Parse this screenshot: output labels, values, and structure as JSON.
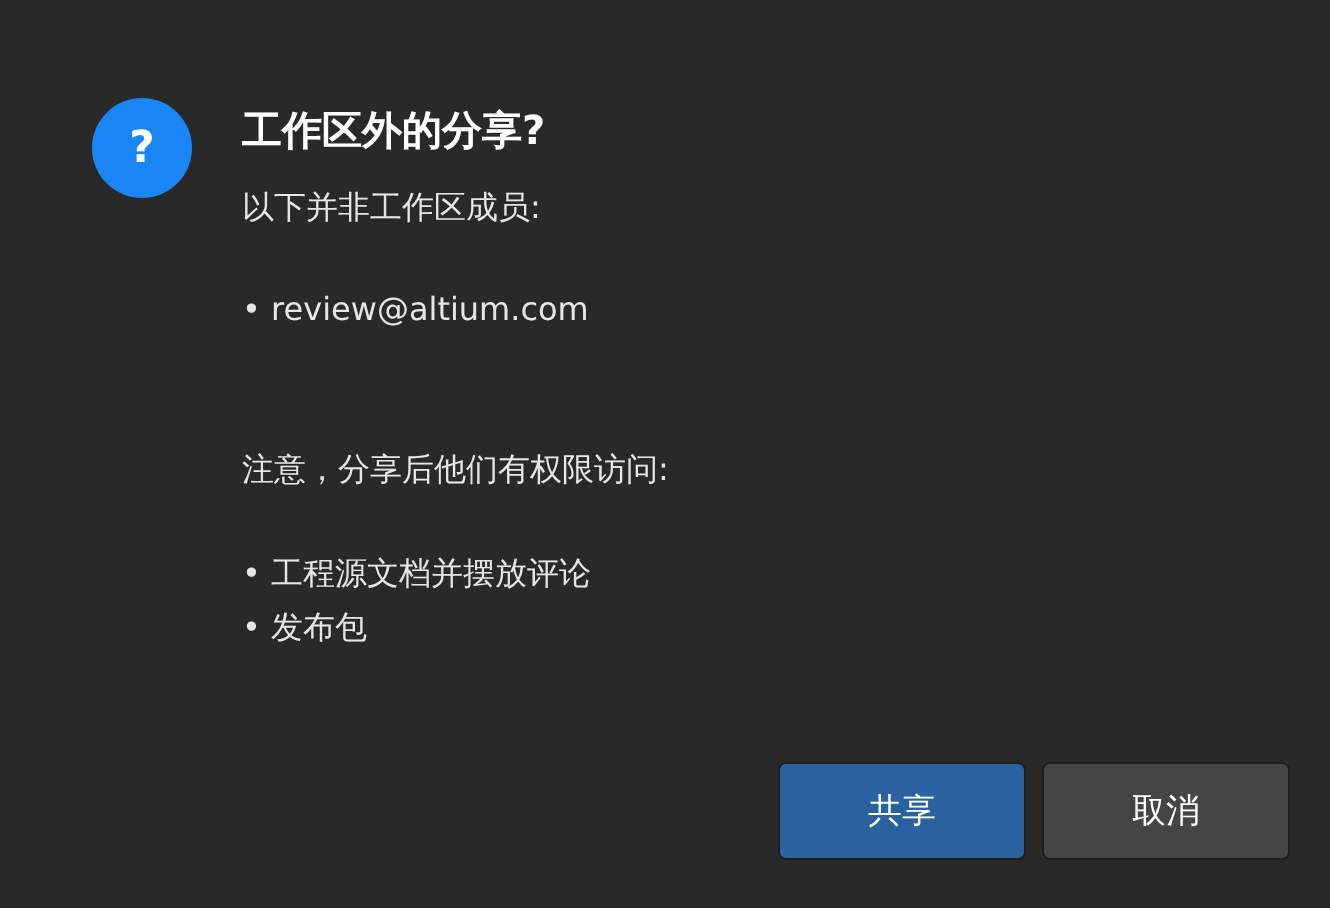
{
  "dialog": {
    "icon_text": "?",
    "title": "工作区外的分享?",
    "intro": "以下并非工作区成员:",
    "members": [
      "• review@altium.com"
    ],
    "note": "注意，分享后他们有权限访问:",
    "permissions": [
      "• 工程源文档并摆放评论",
      "• 发布包"
    ]
  },
  "buttons": [
    {
      "label": "共享",
      "kind": "primary"
    },
    {
      "label": "取消",
      "kind": "secondary"
    }
  ]
}
